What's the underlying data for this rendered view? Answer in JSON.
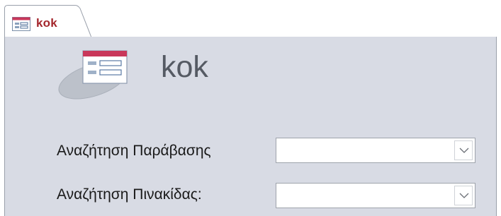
{
  "tab": {
    "label": "kok",
    "icon": "form-icon"
  },
  "form": {
    "title": "kok",
    "header_icon": "form-icon"
  },
  "fields": [
    {
      "label": "Αναζήτηση Παράβασης",
      "value": "",
      "dropdown_icon": "chevron-down-icon"
    },
    {
      "label": "Αναζήτηση Πινακίδας:",
      "value": "",
      "dropdown_icon": "chevron-down-icon"
    }
  ],
  "colors": {
    "tab_text": "#a4262c",
    "form_background": "#d8dbe4",
    "title_text": "#555a63"
  }
}
